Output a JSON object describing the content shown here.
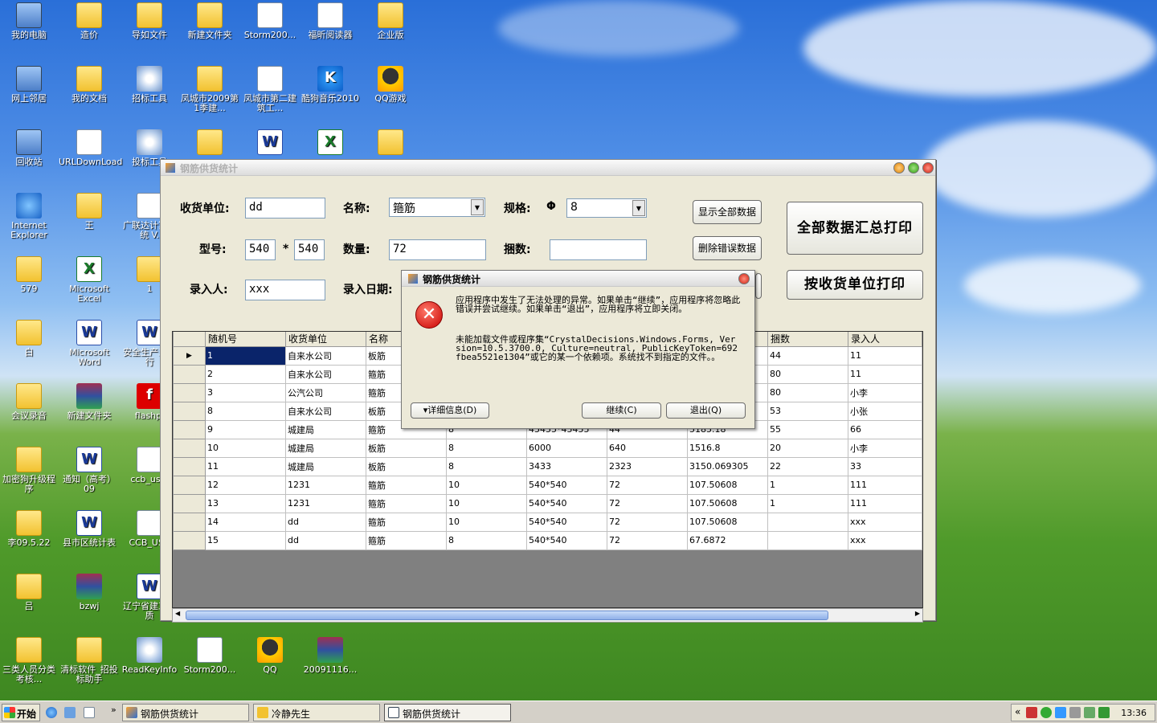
{
  "desktop_icons": [
    {
      "label": "我的电脑",
      "type": "comp"
    },
    {
      "label": "造价",
      "type": "folder"
    },
    {
      "label": "导如文件",
      "type": "folder"
    },
    {
      "label": "新建文件夹",
      "type": "folder"
    },
    {
      "label": "Storm200...",
      "type": "doc"
    },
    {
      "label": "福昕阅读器",
      "type": "doc"
    },
    {
      "label": "企业版",
      "type": "folder"
    },
    {
      "label": "网上邻居",
      "type": "comp"
    },
    {
      "label": "我的文档",
      "type": "folder"
    },
    {
      "label": "招标工具",
      "type": "cd"
    },
    {
      "label": "凤城市2009第1季建...",
      "type": "folder"
    },
    {
      "label": "凤城市第二建筑工...",
      "type": "doc"
    },
    {
      "label": "酷狗音乐2010",
      "type": "music"
    },
    {
      "label": "QQ游戏",
      "type": "qq"
    },
    {
      "label": "回收站",
      "type": "comp"
    },
    {
      "label": "URLDownLoad",
      "type": "doc"
    },
    {
      "label": "投标工具",
      "type": "cd"
    },
    {
      "label": "",
      "type": "folder"
    },
    {
      "label": "",
      "type": "word"
    },
    {
      "label": "",
      "type": "excel"
    },
    {
      "label": "",
      "type": "folder"
    },
    {
      "label": "Internet Explorer",
      "type": "ie"
    },
    {
      "label": "王",
      "type": "folder"
    },
    {
      "label": "广联达计算系统 V.",
      "type": "doc"
    },
    {
      "label": "579",
      "type": "folder"
    },
    {
      "label": "Microsoft Excel",
      "type": "excel"
    },
    {
      "label": "1",
      "type": "folder"
    },
    {
      "label": "白",
      "type": "folder"
    },
    {
      "label": "Microsoft Word",
      "type": "word"
    },
    {
      "label": "安全生产三项行",
      "type": "word"
    },
    {
      "label": "会议录音",
      "type": "folder"
    },
    {
      "label": "新建文件夹",
      "type": "rar"
    },
    {
      "label": "flashpl",
      "type": "red"
    },
    {
      "label": "加密狗升级程序",
      "type": "folder"
    },
    {
      "label": "通知（高考）09",
      "type": "word"
    },
    {
      "label": "ccb_usbl",
      "type": "doc"
    },
    {
      "label": "李09.5.22",
      "type": "folder"
    },
    {
      "label": "县市区统计表",
      "type": "word"
    },
    {
      "label": "CCB_USB",
      "type": "doc"
    },
    {
      "label": "吕",
      "type": "folder"
    },
    {
      "label": "bzwj",
      "type": "rar"
    },
    {
      "label": "辽宁省建工程质",
      "type": "word"
    },
    {
      "label": "三类人员分类考核...",
      "type": "folder"
    },
    {
      "label": "清标软件_招投标助手",
      "type": "folder"
    },
    {
      "label": "ReadKeyInfo",
      "type": "cd"
    },
    {
      "label": "Storm200...",
      "type": "doc"
    },
    {
      "label": "QQ",
      "type": "qq"
    },
    {
      "label": "20091116...",
      "type": "rar"
    }
  ],
  "window": {
    "title": "钢筋供货统计",
    "labels": {
      "receiver": "收货单位:",
      "name": "名称:",
      "spec": "规格:",
      "phi": "Φ",
      "model": "型号:",
      "star": "*",
      "quantity": "数量:",
      "bundles": "捆数:",
      "entered_by": "录入人:",
      "entry_date": "录入日期:"
    },
    "fields": {
      "receiver": "dd",
      "name": "箍筋",
      "spec": "8",
      "model_a": "540",
      "model_b": "540",
      "quantity": "72",
      "bundles": "",
      "entered_by": "xxx"
    },
    "buttons": {
      "show_all": "显示全部数据",
      "delete_error": "删除错误数据",
      "print_all": "全部数据汇总打印",
      "print_by_receiver": "按收货单位打印"
    },
    "grid": {
      "columns": [
        "随机号",
        "收货单位",
        "名称",
        "",
        "",
        "",
        "",
        "捆数",
        "录入人"
      ],
      "rows": [
        [
          "1",
          "自来水公司",
          "板筋",
          "",
          "",
          "",
          "",
          "44",
          "11"
        ],
        [
          "2",
          "自来水公司",
          "箍筋",
          "",
          "",
          "",
          "",
          "80",
          "11"
        ],
        [
          "3",
          "公汽公司",
          "箍筋",
          "",
          "",
          "",
          "",
          "80",
          "小李"
        ],
        [
          "8",
          "自来水公司",
          "板筋",
          "",
          "",
          "",
          "",
          "53",
          "小张"
        ],
        [
          "9",
          "城建局",
          "箍筋",
          "8",
          "45455*45455",
          "44",
          "5185.18",
          "55",
          "66"
        ],
        [
          "10",
          "城建局",
          "板筋",
          "8",
          "6000",
          "640",
          "1516.8",
          "20",
          "小李"
        ],
        [
          "11",
          "城建局",
          "板筋",
          "8",
          "3433",
          "2323",
          "3150.069305",
          "22",
          "33"
        ],
        [
          "12",
          "1231",
          "箍筋",
          "10",
          "540*540",
          "72",
          "107.50608",
          "1",
          "111"
        ],
        [
          "13",
          "1231",
          "箍筋",
          "10",
          "540*540",
          "72",
          "107.50608",
          "1",
          "111"
        ],
        [
          "14",
          "dd",
          "箍筋",
          "10",
          "540*540",
          "72",
          "107.50608",
          "",
          "xxx"
        ],
        [
          "15",
          "dd",
          "箍筋",
          "8",
          "540*540",
          "72",
          "67.6872",
          "",
          "xxx"
        ]
      ]
    }
  },
  "dialog": {
    "title": "钢筋供货统计",
    "message1": "应用程序中发生了无法处理的异常。如果单击“继续”，应用程序将忽略此错误并尝试继续。如果单击“退出”，应用程序将立即关闭。",
    "message2": "未能加载文件或程序集“CrystalDecisions.Windows.Forms, Version=10.5.3700.0, Culture=neutral, PublicKeyToken=692fbea5521e1304”或它的某一个依赖项。系统找不到指定的文件。。",
    "details_button": "详细信息(D)",
    "continue_button": "继续(C)",
    "quit_button": "退出(Q)"
  },
  "taskbar": {
    "start": "开始",
    "tasks": [
      "钢筋供货统计",
      "冷静先生",
      "钢筋供货统计"
    ],
    "clock": "13:36"
  }
}
